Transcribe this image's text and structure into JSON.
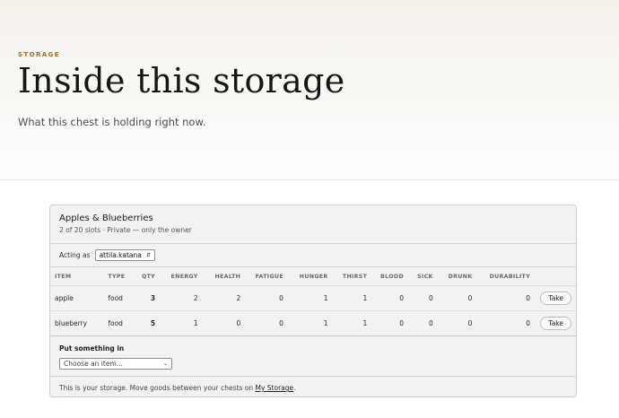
{
  "hero": {
    "eyebrow": "STORAGE",
    "title": "Inside this storage",
    "subtitle": "What this chest is holding right now."
  },
  "storage": {
    "name": "Apples & Blueberries",
    "meta": "2 of 20 slots · Private — only the owner",
    "acting_as_label": "Acting as",
    "acting_as_value": "attila.katana",
    "columns": [
      "ITEM",
      "TYPE",
      "QTY",
      "ENERGY",
      "HEALTH",
      "FATIGUE",
      "HUNGER",
      "THIRST",
      "BLOOD",
      "SICK",
      "DRUNK",
      "DURABILITY",
      ""
    ],
    "rows": [
      {
        "item": "apple",
        "type": "food",
        "qty": "3",
        "energy": "2",
        "health": "2",
        "fatigue": "0",
        "hunger": "1",
        "thirst": "1",
        "blood": "0",
        "sick": "0",
        "drunk": "0",
        "durability": "0",
        "action": "Take"
      },
      {
        "item": "blueberry",
        "type": "food",
        "qty": "5",
        "energy": "1",
        "health": "0",
        "fatigue": "0",
        "hunger": "1",
        "thirst": "1",
        "blood": "0",
        "sick": "0",
        "drunk": "0",
        "durability": "0",
        "action": "Take"
      }
    ],
    "put_label": "Put something in",
    "put_select": "Choose an item...",
    "footer_text": "This is your storage. Move goods between your chests on",
    "footer_link": "My Storage",
    "footer_end": "."
  }
}
